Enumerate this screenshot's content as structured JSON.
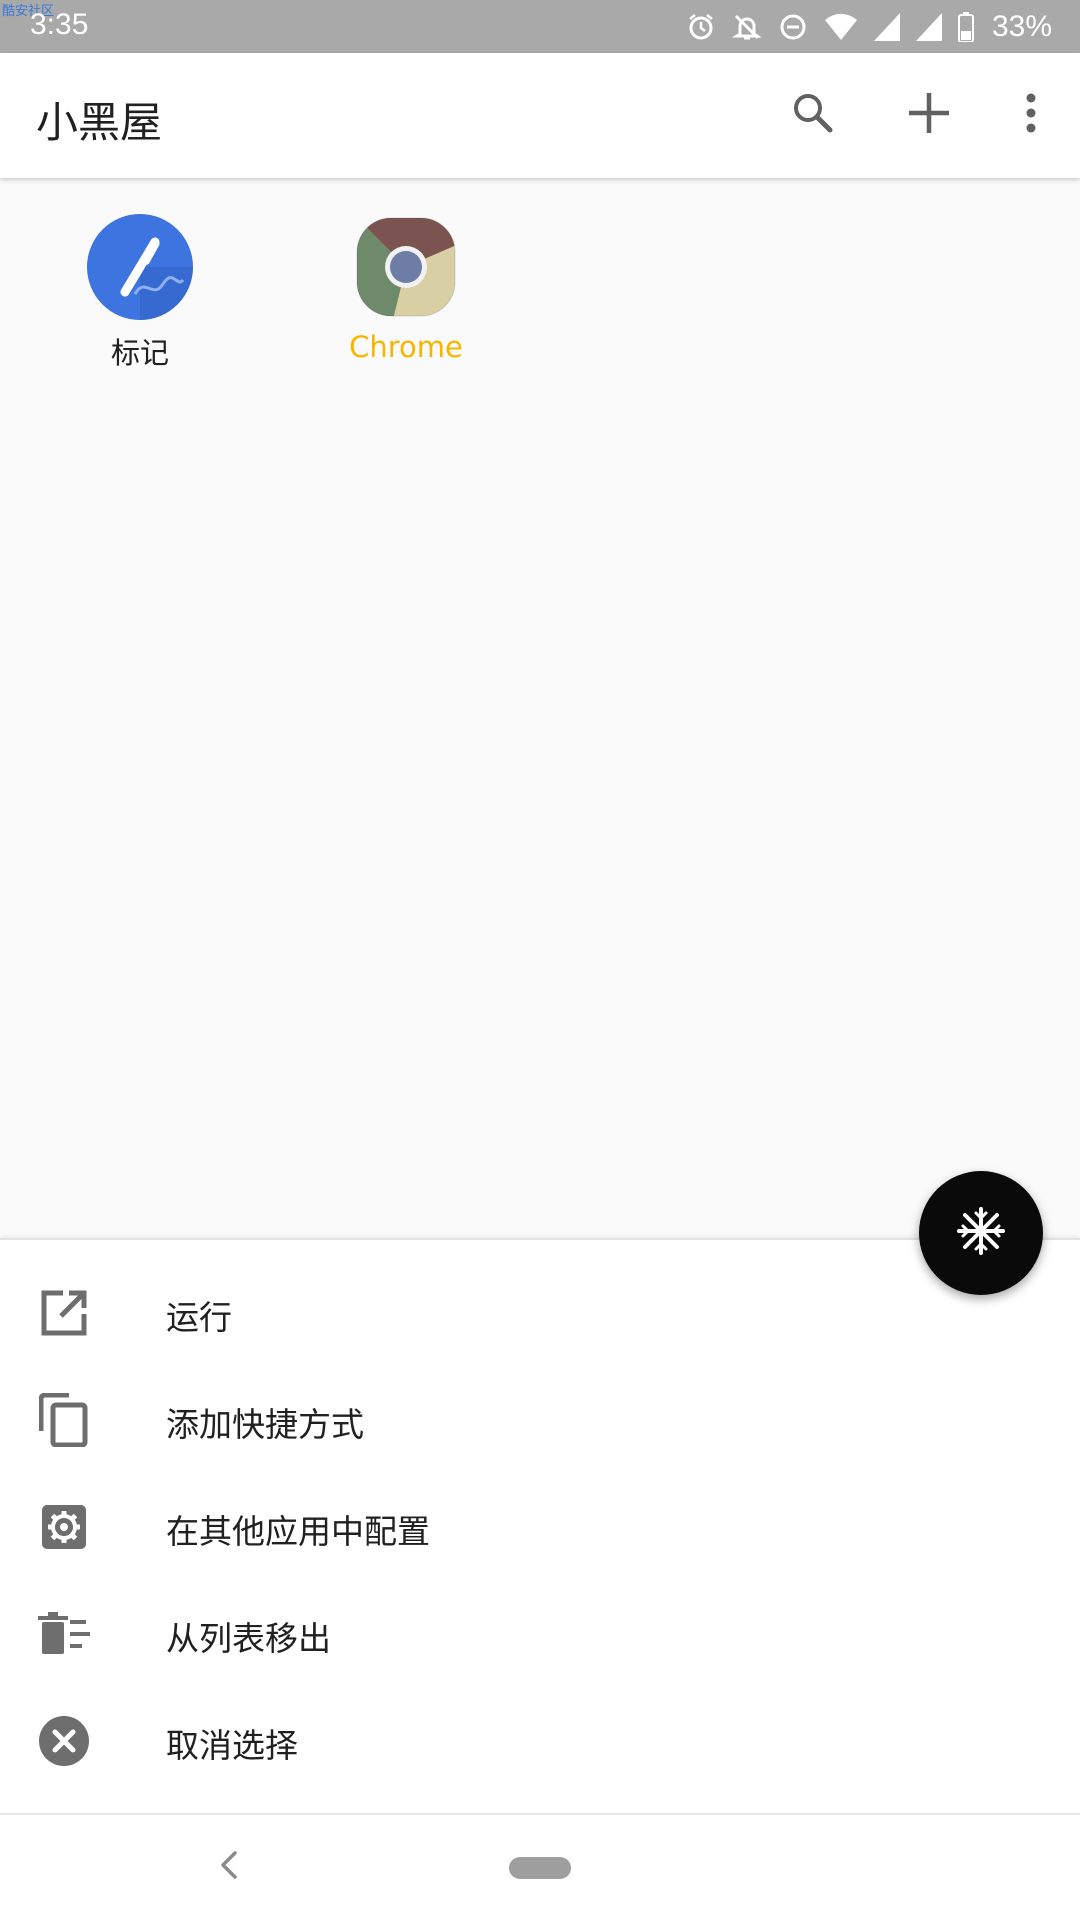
{
  "status_bar": {
    "watermark": "酷安社区",
    "time": "3:35",
    "icons": [
      "alarm-icon",
      "bell-off-icon",
      "dnd-icon",
      "wifi-icon",
      "signal-icon",
      "signal-icon",
      "battery-icon"
    ],
    "battery": "33%"
  },
  "app_bar": {
    "title": "小黑屋",
    "actions": [
      "search-icon",
      "add-icon",
      "more-vert-icon"
    ]
  },
  "apps": [
    {
      "label": "标记",
      "icon": "marker-app-icon",
      "selected": false
    },
    {
      "label": "Chrome",
      "icon": "chrome-app-icon",
      "selected": true
    }
  ],
  "fab": {
    "icon": "snowflake-icon"
  },
  "menu": [
    {
      "label": "运行",
      "icon": "open-in-new-icon"
    },
    {
      "label": "添加快捷方式",
      "icon": "copy-icon"
    },
    {
      "label": "在其他应用中配置",
      "icon": "settings-box-icon"
    },
    {
      "label": "从列表移出",
      "icon": "delete-sweep-icon"
    },
    {
      "label": "取消选择",
      "icon": "cancel-circle-icon"
    }
  ],
  "nav_bar": {
    "back": "back-icon",
    "home": "home-pill"
  },
  "colors": {
    "status_bar": "#a9a9a9",
    "selected_label": "#f6b600",
    "fab": "#0a0a0a",
    "marker_icon": "#3d74e0",
    "menu_icon": "#6e6e6e"
  }
}
